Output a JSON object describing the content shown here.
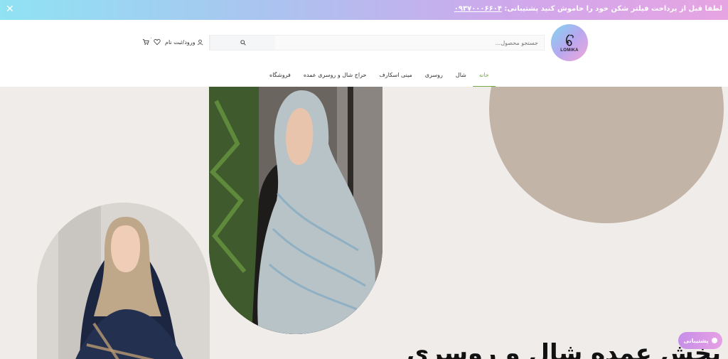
{
  "announcement": {
    "support_label": "پشتیبانی:",
    "support_phone": "۰۹۳۷۰۰۰۶۶۰۴",
    "message": "لطفا قبل از پرداخت فیلتر شکن خود را خاموش کنید",
    "close_icon": "close-icon"
  },
  "brand": {
    "name": "LOMIKA"
  },
  "search": {
    "placeholder": "جستجو محصول...",
    "value": ""
  },
  "user": {
    "login_label": "ورود/ثبت نام",
    "cart_count": "۰"
  },
  "nav": {
    "items": [
      "خانه",
      "شال",
      "روسری",
      "مینی اسکارف",
      "حراج شال و روسری عمده",
      "فروشگاه"
    ],
    "active_index": 0
  },
  "hero": {
    "headline": "پخش عمده شال و روسری"
  },
  "support_chip": {
    "label": "پشتیبانی"
  },
  "colors": {
    "accent": "#7aaa48",
    "blob": "#c2b4a6",
    "hero_bg": "#f0ecea",
    "topbar_start": "#8fe3f3",
    "topbar_end": "#e7a4e2"
  }
}
